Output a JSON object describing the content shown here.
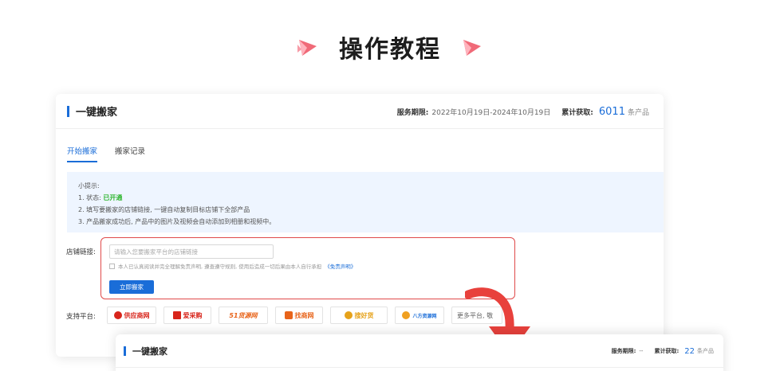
{
  "page": {
    "title": "操作教程"
  },
  "card": {
    "title": "一键搬家",
    "service_label": "服务期限:",
    "service_value": "2022年10月19日-2024年10月19日",
    "total_label": "累计获取:",
    "total_count": "6011",
    "total_unit": "条产品"
  },
  "tabs": [
    {
      "label": "开始搬家",
      "active": true
    },
    {
      "label": "搬家记录",
      "active": false
    }
  ],
  "tips": {
    "title": "小提示:",
    "line1_prefix": "1. 状态:",
    "line1_status": "已开通",
    "line2": "2. 填写要搬家的店铺链接, 一键自动复制目标店铺下全部产品",
    "line3": "3. 产品搬家成功后, 产品中的图片及视频会自动添加到相册和视频中。"
  },
  "form": {
    "store_label": "店铺链接:",
    "url_placeholder": "请输入您要搬家平台的店铺链接",
    "agree_text": "本人已认真阅读并完全理解免责声明, 遵查遵守规则, 使用后造成一切后果由本人自行承担",
    "agree_link": "《免责声明》",
    "submit_label": "立即搬家"
  },
  "platforms": {
    "label": "支持平台:",
    "items": [
      {
        "name": "供应商网",
        "color": "#d8251b"
      },
      {
        "name": "爱采购",
        "color": "#d8251b"
      },
      {
        "name": "51货源网",
        "color": "#e8641a"
      },
      {
        "name": "找商网",
        "color": "#e8641a"
      },
      {
        "name": "搜好货",
        "color": "#e6a21a"
      },
      {
        "name": "八方资源网",
        "color": "#1a6dd8"
      },
      {
        "name": "更多平台, 敬",
        "color": "#666666"
      }
    ]
  },
  "card2": {
    "title": "一键搬家",
    "service_label": "服务期限:",
    "service_value": "--",
    "total_label": "累计获取:",
    "total_count": "22",
    "total_unit": "条产品"
  },
  "colors": {
    "accent": "#1a6dd8",
    "highlight_border": "#e04a4a",
    "arrow": "#e8413c",
    "status_green": "#2db52d"
  }
}
